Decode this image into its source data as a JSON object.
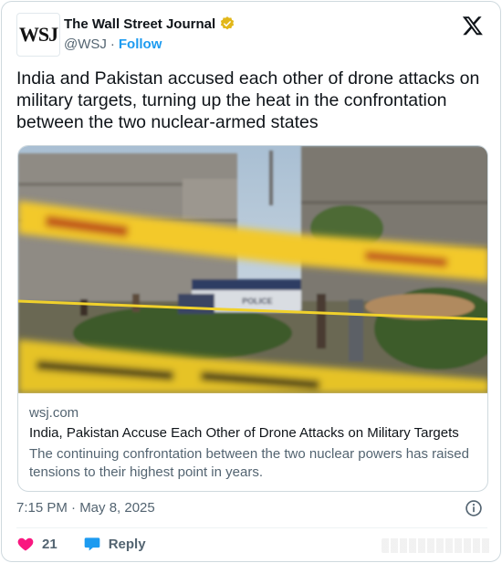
{
  "header": {
    "avatar_text": "WSJ",
    "display_name": "The Wall Street Journal",
    "handle": "@WSJ",
    "separator": "·",
    "follow_label": "Follow",
    "verified_color": "#e2b719"
  },
  "tweet": {
    "text": "India and Pakistan accused each other of drone attacks on military targets, turning up the heat in the confrontation between the two nuclear-armed states"
  },
  "link_card": {
    "image_text": "POLICE",
    "domain": "wsj.com",
    "title": "India, Pakistan Accuse Each Other of Drone Attacks on Military Targets",
    "description": "The continuing confrontation between the two nuclear powers has raised tensions to their highest point in years."
  },
  "meta": {
    "timestamp": "7:15 PM · May 8, 2025"
  },
  "actions": {
    "like_count": "21",
    "reply_label": "Reply"
  },
  "colors": {
    "accent": "#1d9bf0",
    "like": "#f91880",
    "muted": "#536471"
  }
}
